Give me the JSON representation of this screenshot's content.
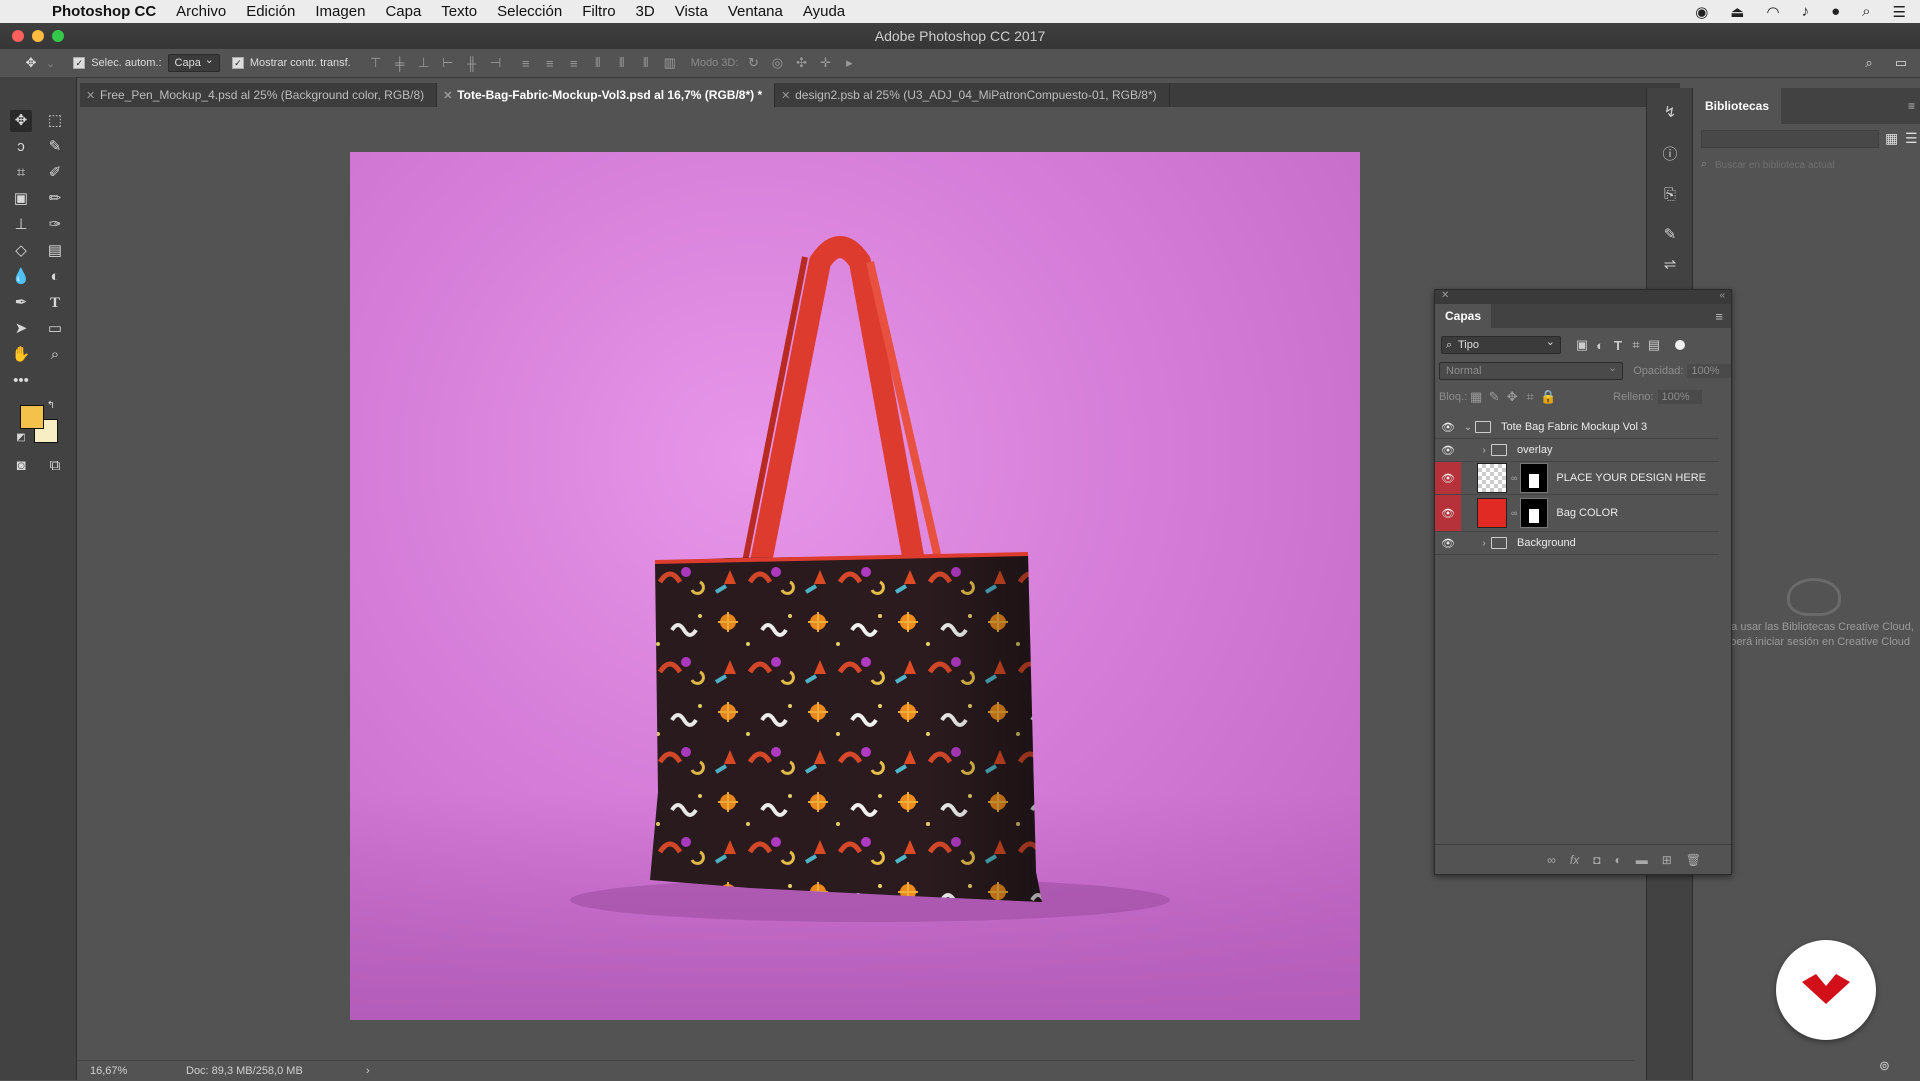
{
  "menubar": {
    "app": "Photoshop CC",
    "items": [
      "Archivo",
      "Edición",
      "Imagen",
      "Capa",
      "Texto",
      "Selección",
      "Filtro",
      "3D",
      "Vista",
      "Ventana",
      "Ayuda"
    ]
  },
  "window": {
    "title": "Adobe Photoshop CC 2017"
  },
  "options": {
    "auto_select_label": "Selec. autom.:",
    "auto_select_value": "Capa",
    "transform_label": "Mostrar contr. transf.",
    "mode3d_label": "Modo 3D:"
  },
  "tabs": [
    {
      "label": "Free_Pen_Mockup_4.psd al 25% (Background color, RGB/8)"
    },
    {
      "label": "Tote-Bag-Fabric-Mockup-Vol3.psd al 16,7% (RGB/8*) *"
    },
    {
      "label": "design2.psb al 25% (U3_ADJ_04_MiPatronCompuesto-01, RGB/8*)"
    }
  ],
  "status": {
    "zoom": "16,67%",
    "doc": "Doc: 89,3 MB/258,0 MB",
    "arrow": "›"
  },
  "libraries": {
    "title": "Bibliotecas",
    "search_placeholder": "Buscar en biblioteca actual",
    "message_1": "Para usar las Bibliotecas Creative Cloud,",
    "message_2": "deberá iniciar sesión en Creative Cloud"
  },
  "layers_panel": {
    "title": "Capas",
    "filter": "Tipo",
    "blend_mode": "Normal",
    "opacity_label": "Opacidad:",
    "opacity_value": "100%",
    "lock_label": "Bloq.:",
    "fill_label": "Relleno:",
    "fill_value": "100%",
    "layers": [
      {
        "name": "Tote Bag Fabric Mockup Vol 3",
        "kind": "group"
      },
      {
        "name": "overlay",
        "kind": "group"
      },
      {
        "name": "PLACE YOUR DESIGN HERE",
        "kind": "smart-object"
      },
      {
        "name": "Bag COLOR",
        "kind": "fill"
      },
      {
        "name": "Background",
        "kind": "group"
      }
    ]
  },
  "colors": {
    "canvas_bg": "#d57dd8",
    "bag_handle": "#dd3b2e",
    "bag_body": "#2b1b1f",
    "foreground_swatch": "#f4c14a",
    "background_swatch": "#f7eec3",
    "layer_highlight": "#b5323a",
    "bag_color_thumb": "#e02a23"
  }
}
